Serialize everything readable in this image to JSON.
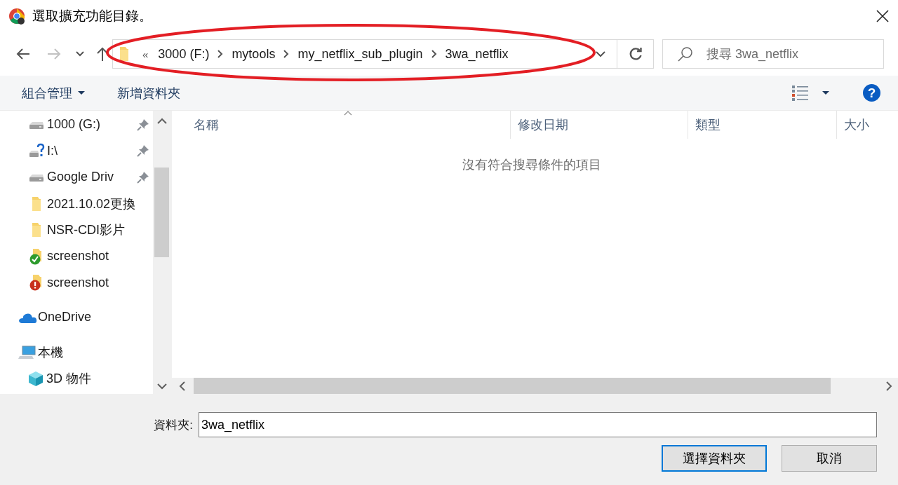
{
  "window": {
    "title": "選取擴充功能目錄。"
  },
  "navigation": {
    "back": {
      "disabled": false
    },
    "forward": {
      "disabled": true
    }
  },
  "address_bar": {
    "overflow": "«",
    "path": [
      "3000 (F:)",
      "mytools",
      "my_netflix_sub_plugin",
      "3wa_netflix"
    ]
  },
  "search": {
    "placeholder": "搜尋 3wa_netflix"
  },
  "toolbar": {
    "organize": "組合管理",
    "new_folder": "新增資料夾",
    "help": "?"
  },
  "sidebar": {
    "quick_access": [
      {
        "label": "1000 (G:)",
        "kind": "drive",
        "pinned": true
      },
      {
        "label": "I:\\",
        "kind": "drive-unknown",
        "pinned": true
      },
      {
        "label": "Google Driv",
        "kind": "drive",
        "pinned": true
      },
      {
        "label": "2021.10.02更換",
        "kind": "folder",
        "pinned": false
      },
      {
        "label": "NSR-CDI影片",
        "kind": "folder",
        "pinned": false
      },
      {
        "label": "screenshot",
        "kind": "folder-ok",
        "pinned": false
      },
      {
        "label": "screenshot",
        "kind": "folder-error",
        "pinned": false
      }
    ],
    "items": [
      {
        "label": "OneDrive",
        "kind": "cloud"
      },
      {
        "label": "本機",
        "kind": "computer",
        "children": [
          {
            "label": "3D 物件",
            "kind": "cube"
          }
        ]
      }
    ]
  },
  "file_list": {
    "columns": [
      {
        "label": "名稱",
        "sorted": true
      },
      {
        "label": "修改日期",
        "sorted": false
      },
      {
        "label": "類型",
        "sorted": false
      },
      {
        "label": "大小",
        "sorted": false
      }
    ],
    "empty_message": "沒有符合搜尋條件的項目"
  },
  "footer": {
    "folder_label": "資料夾:",
    "folder_value": "3wa_netflix",
    "buttons": [
      {
        "label": "選擇資料夾",
        "default": true
      },
      {
        "label": "取消",
        "default": false
      }
    ]
  },
  "annotation": {
    "kind": "ellipse"
  }
}
